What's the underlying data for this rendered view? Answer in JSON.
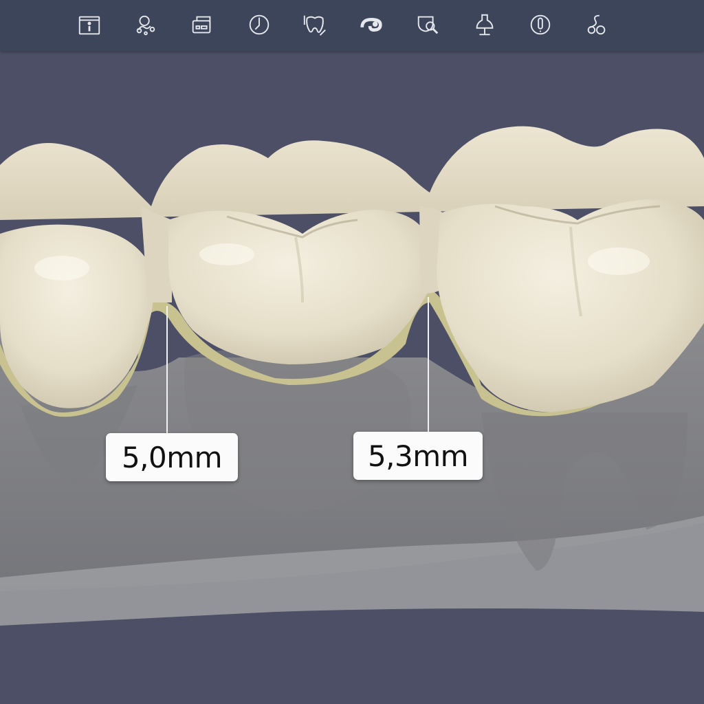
{
  "toolbar": {
    "tools": [
      {
        "id": "info",
        "icon": "info-icon"
      },
      {
        "id": "tooth-library",
        "icon": "tooth-library-icon"
      },
      {
        "id": "scan-data",
        "icon": "scan-data-icon"
      },
      {
        "id": "clock",
        "icon": "clock-icon"
      },
      {
        "id": "tooth-edit",
        "icon": "tooth-edit-icon"
      },
      {
        "id": "morph",
        "icon": "morph-icon"
      },
      {
        "id": "inspect",
        "icon": "inspect-icon"
      },
      {
        "id": "connector",
        "icon": "connector-icon"
      },
      {
        "id": "help",
        "icon": "help-icon"
      },
      {
        "id": "finalize",
        "icon": "finalize-icon"
      }
    ]
  },
  "measurements": [
    {
      "label": "5,0mm"
    },
    {
      "label": "5,3mm"
    }
  ],
  "colors": {
    "background": "#4c4f66",
    "toolbar": "#3c4559",
    "tooth": "#e7e0cc",
    "margin": "#c9c290",
    "gum": "#8a8b8d",
    "label_bg": "#fbfbfb"
  }
}
